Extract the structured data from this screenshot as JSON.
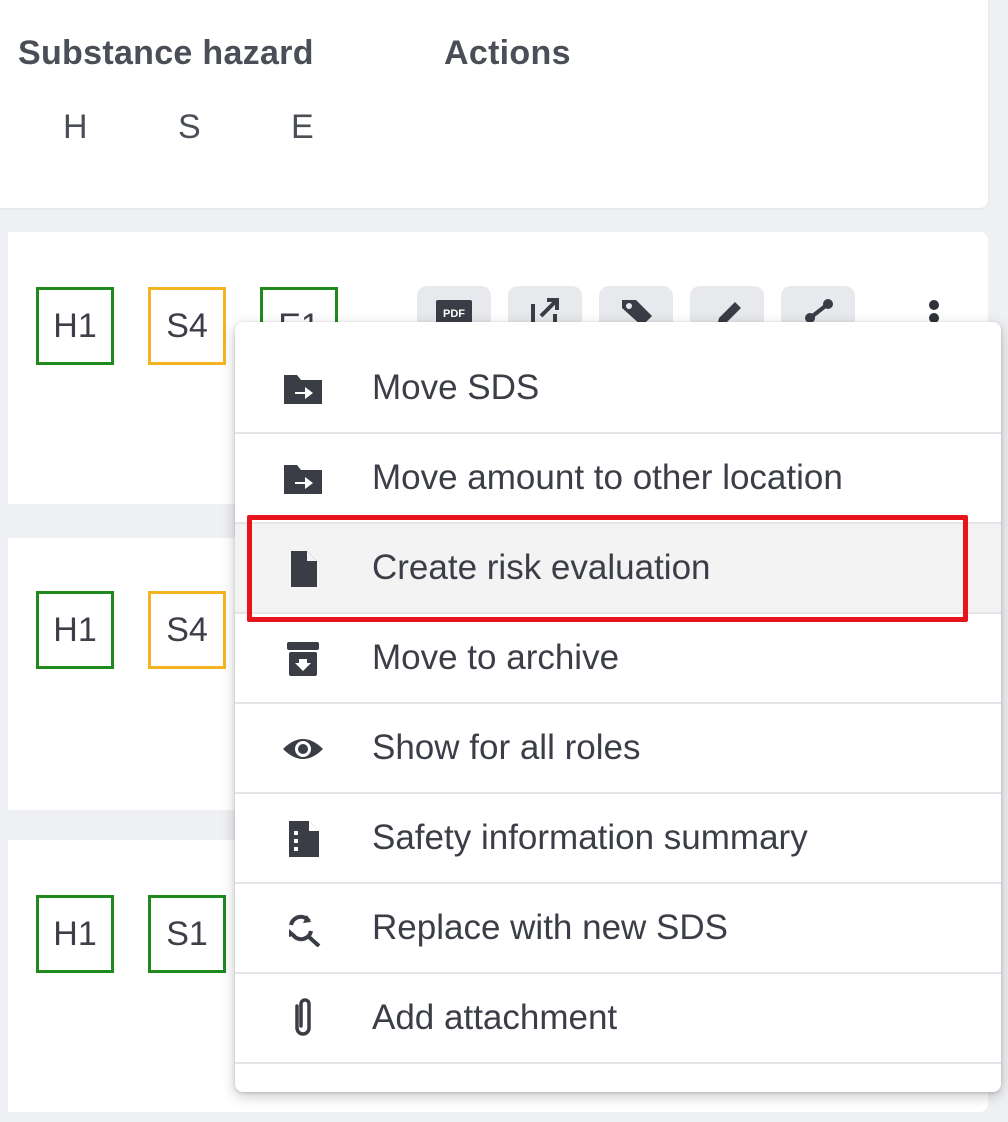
{
  "header": {
    "substance_hazard": "Substance hazard",
    "actions": "Actions",
    "columns": [
      "H",
      "S",
      "E"
    ]
  },
  "rows": [
    {
      "h": "H1",
      "s": "S4",
      "e": "E1"
    },
    {
      "h": "H1",
      "s": "S4"
    },
    {
      "h": "H1",
      "s": "S1"
    }
  ],
  "colors": {
    "green": "#1e8a1e",
    "orange": "#f5b324",
    "highlight": "#e8141b"
  },
  "menu": {
    "items": [
      {
        "label": "Move SDS",
        "icon": "folder-move-icon"
      },
      {
        "label": "Move amount to other location",
        "icon": "folder-move-icon"
      },
      {
        "label": "Create risk evaluation",
        "icon": "file-icon"
      },
      {
        "label": "Move to archive",
        "icon": "archive-icon"
      },
      {
        "label": "Show for all roles",
        "icon": "eye-icon"
      },
      {
        "label": "Safety information summary",
        "icon": "file-summary-icon"
      },
      {
        "label": "Replace with new SDS",
        "icon": "replace-search-icon"
      },
      {
        "label": "Add attachment",
        "icon": "paperclip-icon"
      }
    ]
  }
}
